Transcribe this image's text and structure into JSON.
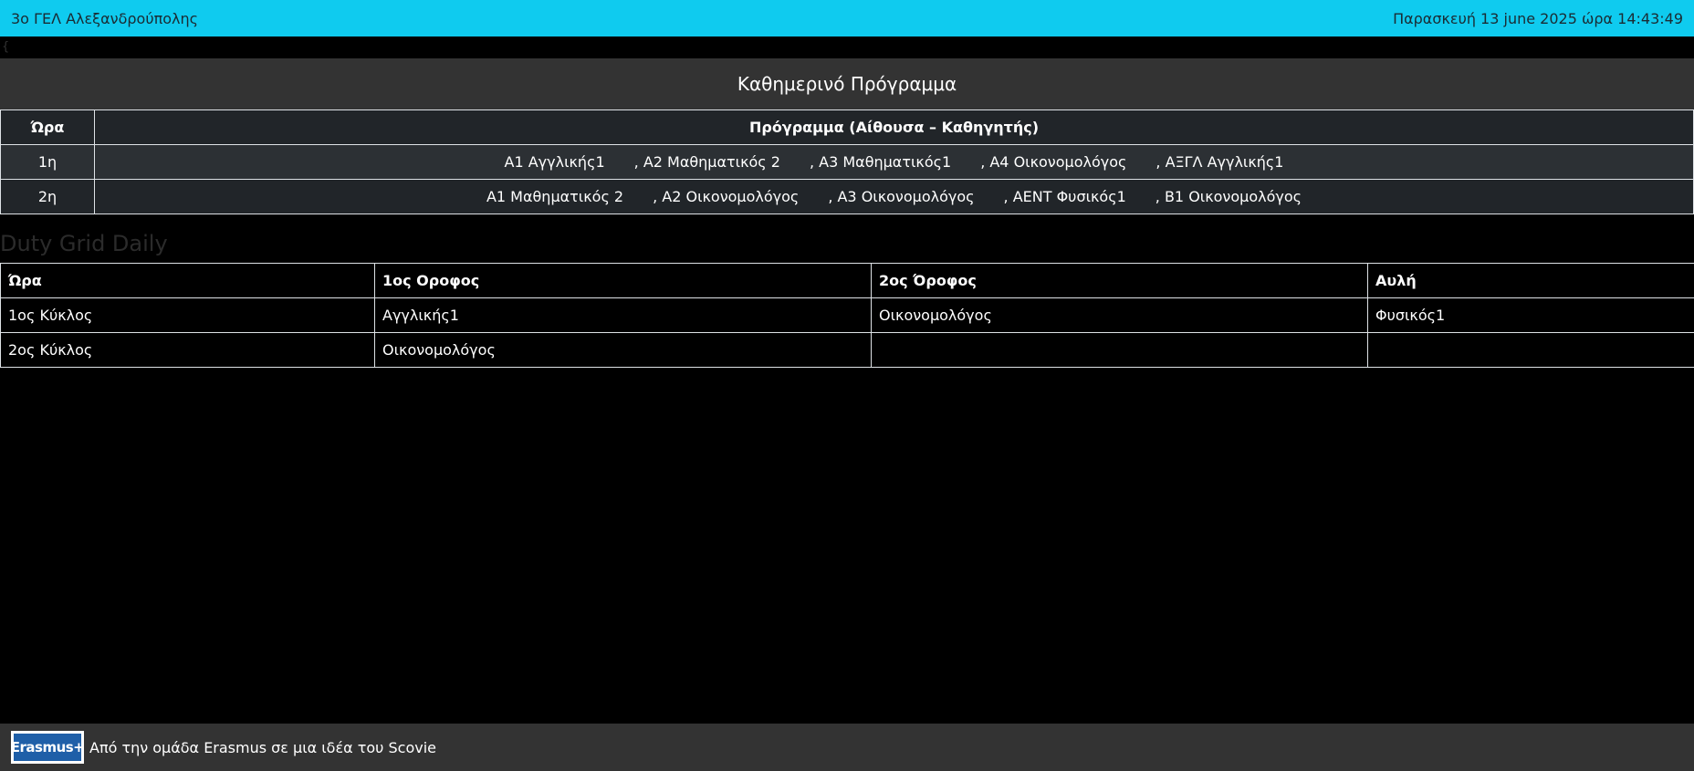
{
  "header": {
    "school_name": "3ο ΓΕΛ Αλεξανδρούπολης",
    "datetime": "Παρασκευή 13 june 2025 ώρα 14:43:49"
  },
  "stray_char": "{",
  "program": {
    "title": "Καθημερινό Πρόγραμμα",
    "columns": [
      "Ώρα",
      "Πρόγραμμα (Αίθουσα – Καθηγητής)"
    ],
    "rows": [
      {
        "hour": "1η",
        "slots": [
          "Α1 Αγγλικής1",
          ", Α2 Μαθηματικός 2",
          ", Α3 Μαθηματικός1",
          ", Α4 Οικονομολόγος",
          ", ΑΞΓΛ Αγγλικής1"
        ]
      },
      {
        "hour": "2η",
        "slots": [
          "Α1 Μαθηματικός 2",
          ", Α2 Οικονομολόγος",
          ", Α3 Οικονομολόγος",
          ", ΑΕΝΤ Φυσικός1",
          ", Β1 Οικονομολόγος"
        ]
      }
    ]
  },
  "duty": {
    "heading": "Duty Grid Daily",
    "columns": [
      "Ώρα",
      "1ος Οροφος",
      "2ος Όροφος",
      "Αυλή"
    ],
    "rows": [
      [
        "1ος Κύκλος",
        "Αγγλικής1",
        "Οικονομολόγος",
        "Φυσικός1"
      ],
      [
        "2ος Κύκλος",
        "Οικονομολόγος",
        "",
        ""
      ]
    ]
  },
  "footer": {
    "logo_text": "Erasmus+",
    "credit": "Από την ομάδα Erasmus σε μια ιδέα του Scovie"
  },
  "colors": {
    "topbar": "#0fcbef",
    "background": "#000000",
    "table_dark": "#212529",
    "footer": "#333333"
  }
}
